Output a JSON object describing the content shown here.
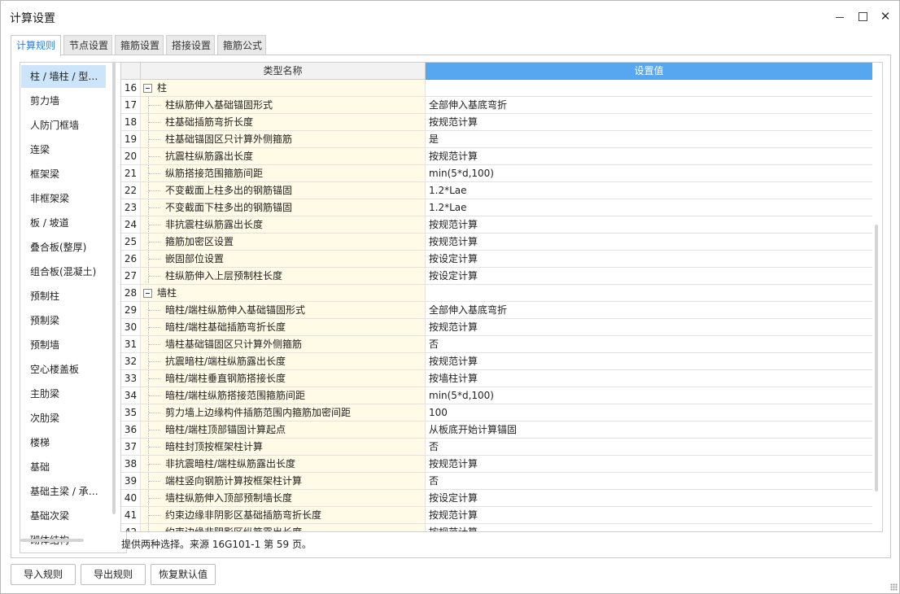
{
  "window": {
    "title": "计算设置"
  },
  "tabs": [
    {
      "label": "计算规则",
      "active": true
    },
    {
      "label": "节点设置",
      "active": false
    },
    {
      "label": "箍筋设置",
      "active": false
    },
    {
      "label": "搭接设置",
      "active": false
    },
    {
      "label": "箍筋公式",
      "active": false
    }
  ],
  "sidebar": {
    "items": [
      {
        "label": "柱 / 墙柱 / 型钢柱",
        "selected": true
      },
      {
        "label": "剪力墙"
      },
      {
        "label": "人防门框墙"
      },
      {
        "label": "连梁"
      },
      {
        "label": "框架梁"
      },
      {
        "label": "非框架梁"
      },
      {
        "label": "板 / 坡道"
      },
      {
        "label": "叠合板(整厚)"
      },
      {
        "label": "组合板(混凝土)"
      },
      {
        "label": "预制柱"
      },
      {
        "label": "预制梁"
      },
      {
        "label": "预制墙"
      },
      {
        "label": "空心楼盖板"
      },
      {
        "label": "主肋梁"
      },
      {
        "label": "次肋梁"
      },
      {
        "label": "楼梯"
      },
      {
        "label": "基础"
      },
      {
        "label": "基础主梁 / 承台梁"
      },
      {
        "label": "基础次梁"
      },
      {
        "label": "砌体结构"
      }
    ]
  },
  "grid": {
    "header": {
      "name": "类型名称",
      "value": "设置值"
    },
    "rows": [
      {
        "num": "16",
        "name": "柱",
        "value": "",
        "group": true
      },
      {
        "num": "17",
        "name": "柱纵筋伸入基础锚固形式",
        "value": "全部伸入基底弯折"
      },
      {
        "num": "18",
        "name": "柱基础插筋弯折长度",
        "value": "按规范计算"
      },
      {
        "num": "19",
        "name": "柱基础锚固区只计算外侧箍筋",
        "value": "是"
      },
      {
        "num": "20",
        "name": "抗震柱纵筋露出长度",
        "value": "按规范计算"
      },
      {
        "num": "21",
        "name": "纵筋搭接范围箍筋间距",
        "value": "min(5*d,100)"
      },
      {
        "num": "22",
        "name": "不变截面上柱多出的钢筋锚固",
        "value": "1.2*Lae"
      },
      {
        "num": "23",
        "name": "不变截面下柱多出的钢筋锚固",
        "value": "1.2*Lae"
      },
      {
        "num": "24",
        "name": "非抗震柱纵筋露出长度",
        "value": "按规范计算"
      },
      {
        "num": "25",
        "name": "箍筋加密区设置",
        "value": "按规范计算"
      },
      {
        "num": "26",
        "name": "嵌固部位设置",
        "value": "按设定计算"
      },
      {
        "num": "27",
        "name": "柱纵筋伸入上层预制柱长度",
        "value": "按设定计算"
      },
      {
        "num": "28",
        "name": "墙柱",
        "value": "",
        "group": true
      },
      {
        "num": "29",
        "name": "暗柱/端柱纵筋伸入基础锚固形式",
        "value": "全部伸入基底弯折"
      },
      {
        "num": "30",
        "name": "暗柱/端柱基础插筋弯折长度",
        "value": "按规范计算"
      },
      {
        "num": "31",
        "name": "墙柱基础锚固区只计算外侧箍筋",
        "value": "否"
      },
      {
        "num": "32",
        "name": "抗震暗柱/端柱纵筋露出长度",
        "value": "按规范计算"
      },
      {
        "num": "33",
        "name": "暗柱/端柱垂直钢筋搭接长度",
        "value": "按墙柱计算"
      },
      {
        "num": "34",
        "name": "暗柱/端柱纵筋搭接范围箍筋间距",
        "value": "min(5*d,100)"
      },
      {
        "num": "35",
        "name": "剪力墙上边缘构件插筋范围内箍筋加密间距",
        "value": "100"
      },
      {
        "num": "36",
        "name": "暗柱/端柱顶部锚固计算起点",
        "value": "从板底开始计算锚固"
      },
      {
        "num": "37",
        "name": "暗柱封顶按框架柱计算",
        "value": "否"
      },
      {
        "num": "38",
        "name": "非抗震暗柱/端柱纵筋露出长度",
        "value": "按规范计算"
      },
      {
        "num": "39",
        "name": "端柱竖向钢筋计算按框架柱计算",
        "value": "否"
      },
      {
        "num": "40",
        "name": "墙柱纵筋伸入顶部预制墙长度",
        "value": "按设定计算"
      },
      {
        "num": "41",
        "name": "约束边缘非阴影区基础插筋弯折长度",
        "value": "按规范计算"
      },
      {
        "num": "42",
        "name": "约束边缘非阴影区纵筋露出长度",
        "value": "按规范计算"
      }
    ]
  },
  "hint": "提供两种选择。来源 16G101-1 第 59 页。",
  "buttons": {
    "import": "导入规则",
    "export": "导出规则",
    "restore": "恢复默认值"
  }
}
